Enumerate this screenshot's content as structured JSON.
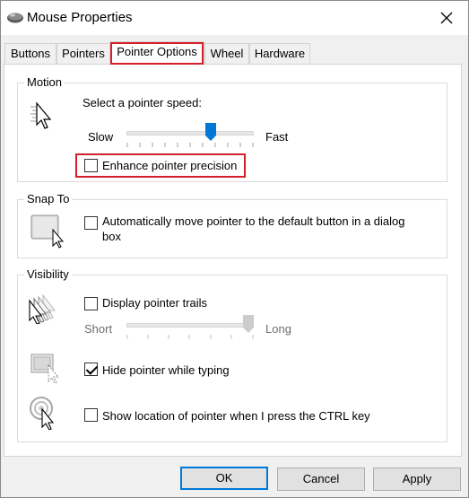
{
  "window": {
    "title": "Mouse Properties"
  },
  "tabs": [
    {
      "label": "Buttons"
    },
    {
      "label": "Pointers"
    },
    {
      "label": "Pointer Options"
    },
    {
      "label": "Wheel"
    },
    {
      "label": "Hardware"
    }
  ],
  "active_tab": "Pointer Options",
  "motion": {
    "group_label": "Motion",
    "speed_label": "Select a pointer speed:",
    "slow_label": "Slow",
    "fast_label": "Fast",
    "speed_value": 0.68,
    "enhance_label": "Enhance pointer precision",
    "enhance_checked": false
  },
  "snap_to": {
    "group_label": "Snap To",
    "auto_move_label_line1": "Automatically move pointer to the default button in a dialog",
    "auto_move_label_line2": "box",
    "auto_move_checked": false
  },
  "visibility": {
    "group_label": "Visibility",
    "trails_label": "Display pointer trails",
    "trails_checked": false,
    "short_label": "Short",
    "long_label": "Long",
    "trail_length_value": 1.0,
    "hide_label": "Hide pointer while typing",
    "hide_checked": true,
    "show_ctrl_label": "Show location of pointer when I press the CTRL key",
    "show_ctrl_checked": false
  },
  "buttons": {
    "ok": "OK",
    "cancel": "Cancel",
    "apply": "Apply"
  },
  "colors": {
    "highlight": "#d5202a",
    "accent": "#0078d7",
    "slider_thumb": "#0078d7"
  }
}
